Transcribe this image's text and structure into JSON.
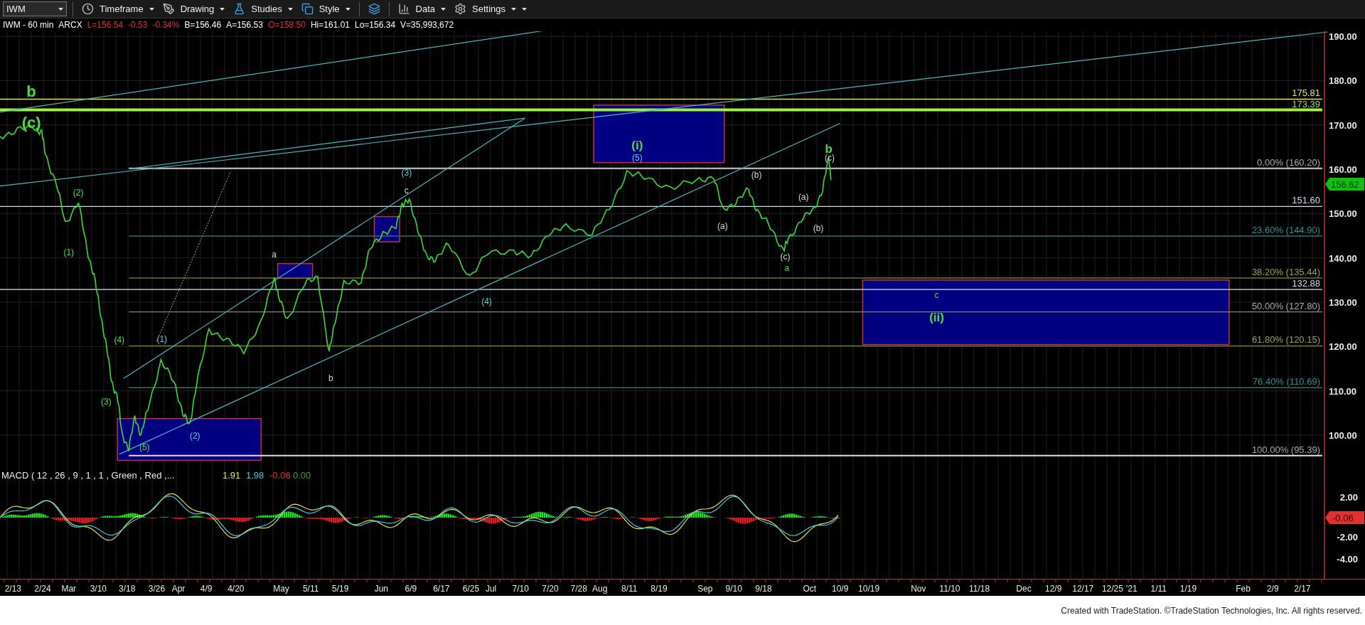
{
  "toolbar": {
    "symbol": "IWM",
    "menus": [
      {
        "label": "Timeframe",
        "kind": "clock"
      },
      {
        "label": "Drawing",
        "kind": "pen"
      },
      {
        "label": "Studies",
        "kind": "flask"
      },
      {
        "label": "Style",
        "kind": "style"
      },
      {
        "kind": "layout"
      },
      {
        "label": "Data",
        "kind": "data"
      },
      {
        "label": "Settings",
        "kind": "gear"
      }
    ]
  },
  "quote": [
    {
      "text": "IWM - 60 min",
      "color": "#ffffff"
    },
    {
      "text": "ARCX",
      "color": "#ffffff"
    },
    {
      "text": "L=156.54",
      "color": "#e03030"
    },
    {
      "text": "-0.53",
      "color": "#e03030"
    },
    {
      "text": "-0.34%",
      "color": "#e03030"
    },
    {
      "text": "B=156.46",
      "color": "#ffffff"
    },
    {
      "text": "A=156.53",
      "color": "#ffffff"
    },
    {
      "text": "O=158.50",
      "color": "#e03030"
    },
    {
      "text": "Hi=161.01",
      "color": "#ffffff"
    },
    {
      "text": "Lo=156.34",
      "color": "#ffffff"
    },
    {
      "text": "V=35,993,672",
      "color": "#ffffff"
    }
  ],
  "price_panel": {
    "wave_labels": [
      {
        "text": "b",
        "color": "#40e040",
        "kind": "major"
      },
      {
        "text": "(c)",
        "color": "#40e040",
        "kind": "major"
      },
      {
        "text": "(2)",
        "color": "#40e040",
        "kind": "minor"
      },
      {
        "text": "(1)",
        "color": "#40e040",
        "kind": "minor"
      },
      {
        "text": "(4)",
        "color": "#40e040",
        "kind": "minor"
      },
      {
        "text": "(3)",
        "color": "#40e040",
        "kind": "minor"
      },
      {
        "text": "(5)",
        "color": "#40e040",
        "kind": "minor"
      },
      {
        "text": "(1)",
        "color": "#60c8d0",
        "kind": "minor"
      },
      {
        "text": "(2)",
        "color": "#60c8d0",
        "kind": "minor"
      },
      {
        "text": "a",
        "color": "#d0d0d0",
        "kind": "minor"
      },
      {
        "text": "b",
        "color": "#d0d0d0",
        "kind": "minor"
      },
      {
        "text": "(3)",
        "color": "#60c8d0",
        "kind": "minor"
      },
      {
        "text": "c",
        "color": "#d0d0d0",
        "kind": "minor"
      },
      {
        "text": "(4)",
        "color": "#60c8d0",
        "kind": "minor"
      },
      {
        "text": "(i)",
        "color": "#40e040",
        "kind": "major"
      },
      {
        "text": "(5)",
        "color": "#60c8d0",
        "kind": "minor"
      },
      {
        "text": "(a)",
        "color": "#d0d0d0",
        "kind": "minor"
      },
      {
        "text": "(b)",
        "color": "#d0d0d0",
        "kind": "minor"
      },
      {
        "text": "(c)",
        "color": "#d0d0d0",
        "kind": "minor"
      },
      {
        "text": "a",
        "color": "#40e040",
        "kind": "minor"
      },
      {
        "text": "(a)",
        "color": "#d0d0d0",
        "kind": "minor"
      },
      {
        "text": "(b)",
        "color": "#d0d0d0",
        "kind": "minor"
      },
      {
        "text": "b",
        "color": "#40e040",
        "kind": "major"
      },
      {
        "text": "(c)",
        "color": "#d0d0d0",
        "kind": "minor"
      },
      {
        "text": "c",
        "color": "#40e040",
        "kind": "minor"
      },
      {
        "text": "(ii)",
        "color": "#40e040",
        "kind": "major"
      }
    ],
    "levels": [
      {
        "label": "175.81",
        "color": "#e0e060"
      },
      {
        "label": "173.39",
        "color": "#90e040"
      },
      {
        "label": "0.00% (160.20)",
        "color": "#a8a8a8"
      },
      {
        "label": "151.60",
        "color": "#c8d8f0"
      },
      {
        "label": "23.60% (144.90)",
        "color": "#2a9090"
      },
      {
        "label": "38.20% (135.44)",
        "color": "#a0a040"
      },
      {
        "label": "132.88",
        "color": "#c8d8f0"
      },
      {
        "label": "50.00% (127.80)",
        "color": "#a8a8a8"
      },
      {
        "label": "61.80% (120.15)",
        "color": "#a0a040"
      },
      {
        "label": "76.40% (110.69)",
        "color": "#2a9090"
      },
      {
        "label": "100.00% (95.39)",
        "color": "#a8a8a8"
      }
    ],
    "y_ticks": [
      "190.00",
      "180.00",
      "170.00",
      "160.00",
      "150.00",
      "140.00",
      "130.00",
      "120.00",
      "110.00",
      "100.00"
    ],
    "last_price": "156.62"
  },
  "macd_panel": {
    "title": "MACD ( 12 , 26 , 9 , 1 , 1 , Green , Red ,...",
    "values": [
      {
        "text": "1.91",
        "color": "#e0e040"
      },
      {
        "text": "1.98",
        "color": "#40c8e0"
      },
      {
        "text": "-0.06",
        "color": "#e03030"
      },
      {
        "text": "0.00",
        "color": "#30a030"
      }
    ],
    "y_ticks": [
      "2.00",
      "-2.00",
      "-4.00"
    ],
    "last_value": "-0.06"
  },
  "date_axis": [
    "2/13",
    "2/24",
    "Mar",
    "3/10",
    "3/18",
    "3/26",
    "Apr",
    "4/9",
    "4/20",
    "May",
    "5/11",
    "5/19",
    "Jun",
    "6/9",
    "6/17",
    "6/25",
    "Jul",
    "7/10",
    "7/20",
    "7/28",
    "Aug",
    "8/11",
    "8/19",
    "Sep",
    "9/10",
    "9/18",
    "Oct",
    "10/9",
    "10/19",
    "Nov",
    "11/10",
    "11/18",
    "Dec",
    "12/9",
    "12/17",
    "12/25",
    "'21",
    "1/11",
    "1/19",
    "Feb",
    "2/9",
    "2/17"
  ],
  "footer": "Created with TradeStation. ©TradeStation Technologies, Inc. All rights reserved."
}
